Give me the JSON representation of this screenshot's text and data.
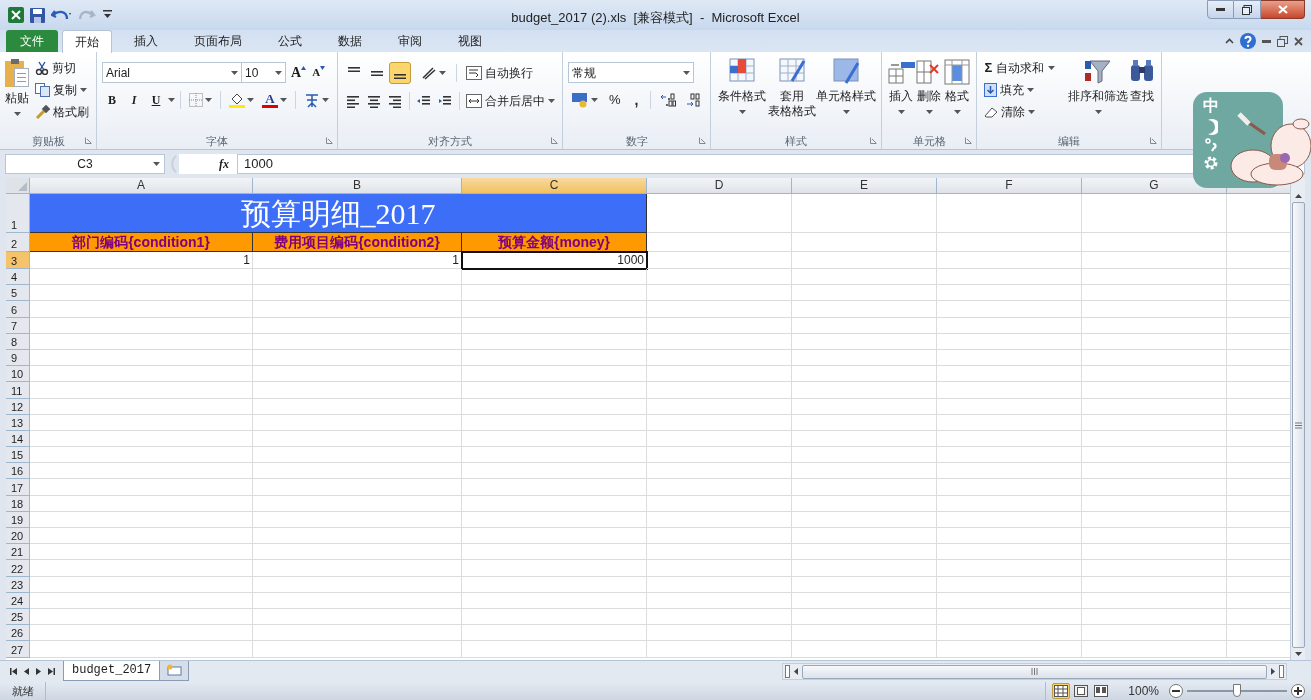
{
  "window": {
    "title": "budget_2017 (2).xls  [兼容模式]  -  Microsoft Excel"
  },
  "tabs": [
    {
      "label": "文件",
      "kind": "file",
      "selected": false
    },
    {
      "label": "开始",
      "kind": "tab",
      "selected": true
    },
    {
      "label": "插入",
      "kind": "tab",
      "selected": false
    },
    {
      "label": "页面布局",
      "kind": "tab",
      "selected": false
    },
    {
      "label": "公式",
      "kind": "tab",
      "selected": false
    },
    {
      "label": "数据",
      "kind": "tab",
      "selected": false
    },
    {
      "label": "审阅",
      "kind": "tab",
      "selected": false
    },
    {
      "label": "视图",
      "kind": "tab",
      "selected": false
    }
  ],
  "ribbon": {
    "clipboard": {
      "label": "剪贴板",
      "paste": "粘贴",
      "cut": "剪切",
      "copy": "复制",
      "painter": "格式刷"
    },
    "font": {
      "label": "字体",
      "name": "Arial",
      "size": "10",
      "grow": "A",
      "shrink": "A",
      "bold": "B",
      "italic": "I",
      "underline": "U",
      "font_color": "A"
    },
    "alignment": {
      "label": "对齐方式",
      "wrap": "自动换行",
      "merge": "合并后居中",
      "bottom_align_selected": true
    },
    "number": {
      "label": "数字",
      "format": "常规",
      "percent": "%",
      "comma": ","
    },
    "styles": {
      "label": "样式",
      "conditional": "条件格式",
      "table_1": "套用",
      "table_2": "表格格式",
      "cell_styles": "单元格样式"
    },
    "cells": {
      "label": "单元格",
      "buttons": [
        "插入",
        "删除",
        "格式"
      ]
    },
    "editing": {
      "label": "编辑",
      "sigma": "Σ",
      "autosum": "自动求和",
      "fill": "填充",
      "clear": "清除",
      "sort": "排序和筛选",
      "find": "查找"
    }
  },
  "formula_bar": {
    "name_box": "C3",
    "fx": "fx",
    "formula": "1000"
  },
  "sheet": {
    "columns": [
      {
        "label": "A",
        "selected": false
      },
      {
        "label": "B",
        "selected": false
      },
      {
        "label": "C",
        "selected": true
      },
      {
        "label": "D",
        "selected": false
      },
      {
        "label": "E",
        "selected": false
      },
      {
        "label": "F",
        "selected": false
      },
      {
        "label": "G",
        "selected": false
      }
    ],
    "rows": [
      {
        "label": "1",
        "selected": false
      },
      {
        "label": "2",
        "selected": false
      },
      {
        "label": "3",
        "selected": true
      },
      {
        "label": "4",
        "selected": false
      },
      {
        "label": "5",
        "selected": false
      },
      {
        "label": "6",
        "selected": false
      },
      {
        "label": "7",
        "selected": false
      },
      {
        "label": "8",
        "selected": false
      },
      {
        "label": "9",
        "selected": false
      },
      {
        "label": "10",
        "selected": false
      },
      {
        "label": "11",
        "selected": false
      },
      {
        "label": "12",
        "selected": false
      },
      {
        "label": "13",
        "selected": false
      },
      {
        "label": "14",
        "selected": false
      },
      {
        "label": "15",
        "selected": false
      },
      {
        "label": "16",
        "selected": false
      },
      {
        "label": "17",
        "selected": false
      },
      {
        "label": "18",
        "selected": false
      },
      {
        "label": "19",
        "selected": false
      },
      {
        "label": "20",
        "selected": false
      },
      {
        "label": "21",
        "selected": false
      },
      {
        "label": "22",
        "selected": false
      },
      {
        "label": "23",
        "selected": false
      },
      {
        "label": "24",
        "selected": false
      },
      {
        "label": "25",
        "selected": false
      },
      {
        "label": "26",
        "selected": false
      },
      {
        "label": "27",
        "selected": false
      }
    ],
    "title": "预算明细_2017",
    "headers": [
      "部门编码{condition1}",
      "费用项目编码{condition2}",
      "预算金额{money}"
    ],
    "values": [
      "1",
      "1",
      "1000"
    ]
  },
  "sheet_tabs": [
    {
      "label": "budget_2017",
      "selected": true
    }
  ],
  "status_bar": {
    "text": "就绪",
    "views": [
      {
        "selected": true
      },
      {
        "selected": false
      },
      {
        "selected": false
      }
    ],
    "zoom": "100%",
    "level": 0.5
  },
  "ime": {
    "label": "中"
  }
}
